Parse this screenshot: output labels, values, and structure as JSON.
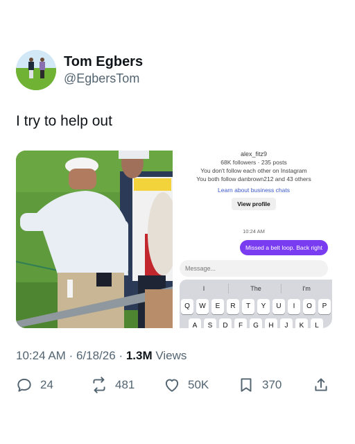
{
  "author": {
    "name": "Tom Egbers",
    "handle": "@EgbersTom"
  },
  "tweet": {
    "text": "I try to help out",
    "time": "10:24 AM",
    "date": "6/18/26",
    "views_count": "1.3M",
    "views_label": "Views",
    "separator": "·"
  },
  "instagram_screenshot": {
    "username": "alex_fitz9",
    "stats": "68K followers · 235 posts",
    "follow_status": "You don't follow each other on Instagram",
    "mutuals": "You both follow danbrown212 and 43 others",
    "business_link": "Learn about business chats",
    "view_profile": "View profile",
    "timestamp": "10:24 AM",
    "message_bubble": "Missed a belt loop. Back right",
    "input_placeholder": "Message...",
    "suggestions": [
      "I",
      "The",
      "I'm"
    ],
    "keyboard_row1": [
      "Q",
      "W",
      "E",
      "R",
      "T",
      "Y",
      "U",
      "I",
      "O",
      "P"
    ],
    "keyboard_row2": [
      "A",
      "S",
      "D",
      "F",
      "G",
      "H",
      "J",
      "K",
      "L"
    ]
  },
  "actions": {
    "replies": "24",
    "reposts": "481",
    "likes": "50K",
    "bookmarks": "370"
  },
  "icons": [
    "reply-icon",
    "repost-icon",
    "like-icon",
    "bookmark-icon",
    "share-icon"
  ]
}
